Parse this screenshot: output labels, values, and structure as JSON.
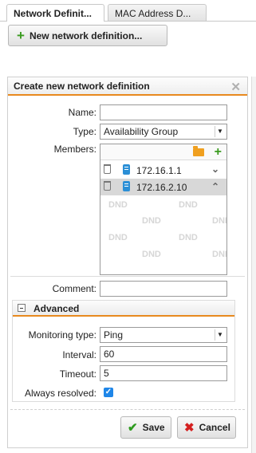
{
  "tabs": [
    {
      "label": "Network Definit...",
      "active": true
    },
    {
      "label": "MAC Address D...",
      "active": false
    }
  ],
  "toolbar": {
    "new_button_label": "New network definition...",
    "new_button_icon": "plus-icon"
  },
  "dialog": {
    "title": "Create new network definition",
    "close_icon": "close-icon",
    "fields": {
      "name": {
        "label": "Name:",
        "value": ""
      },
      "type": {
        "label": "Type:",
        "value": "Availability Group"
      },
      "members": {
        "label": "Members:",
        "items": [
          {
            "address": "172.16.1.1",
            "selected": false,
            "chevron": "chevron-down-icon"
          },
          {
            "address": "172.16.2.10",
            "selected": true,
            "chevron": "chevron-up-icon"
          }
        ],
        "placeholder": "DND"
      },
      "comment": {
        "label": "Comment:",
        "value": ""
      }
    },
    "advanced": {
      "title": "Advanced",
      "monitoring_type": {
        "label": "Monitoring type:",
        "value": "Ping"
      },
      "interval": {
        "label": "Interval:",
        "value": "60"
      },
      "timeout": {
        "label": "Timeout:",
        "value": "5"
      },
      "always_resolved": {
        "label": "Always resolved:",
        "checked": true
      }
    },
    "buttons": {
      "save": "Save",
      "cancel": "Cancel"
    }
  },
  "colors": {
    "accent_orange": "#e8891e",
    "plus_green": "#3a9b1f",
    "checkbox_blue": "#1f86e8",
    "cancel_red": "#d42020",
    "host_blue": "#2b8fd6"
  }
}
